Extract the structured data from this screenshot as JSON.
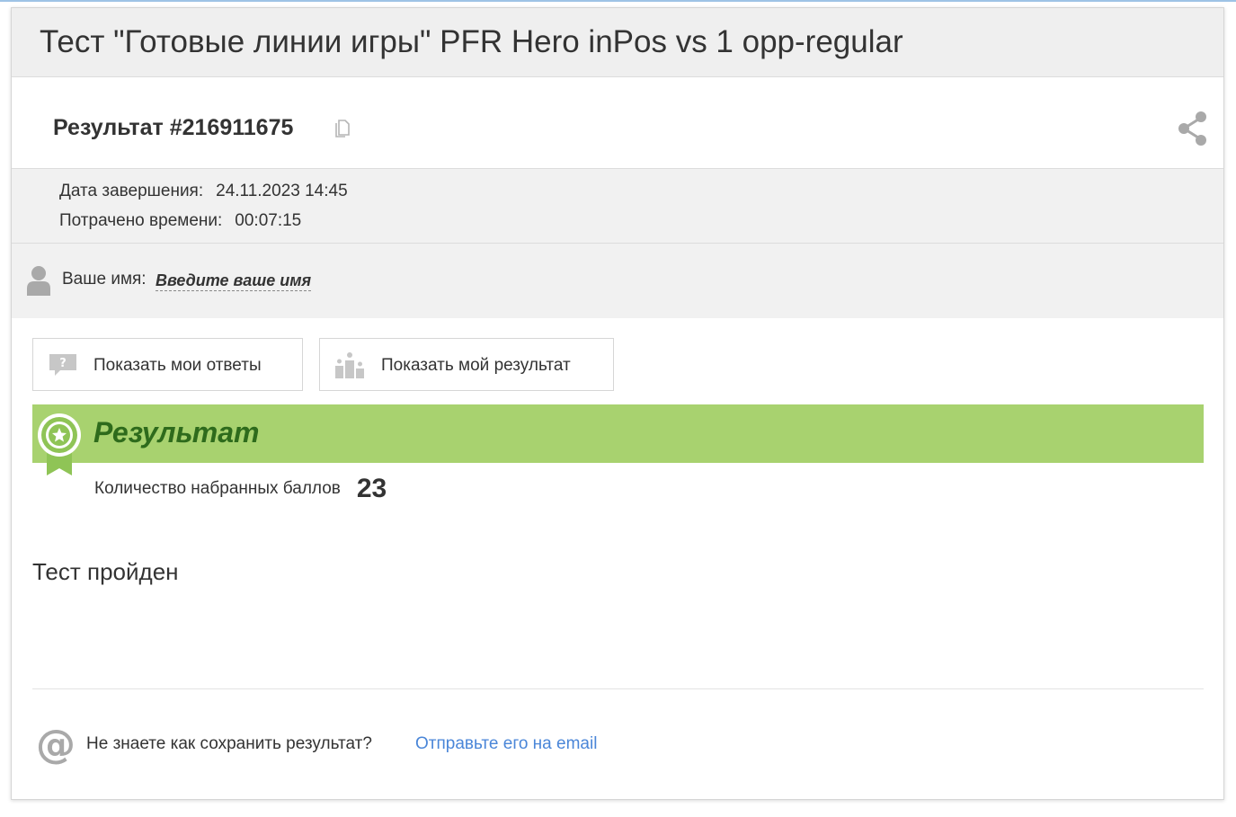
{
  "header": {
    "title": "Тест \"Готовые линии игры\" PFR Hero inPos vs 1 opp-regular"
  },
  "result": {
    "title": "Результат #216911675"
  },
  "meta": {
    "completion_label": "Дата завершения:",
    "completion_value": "24.11.2023 14:45",
    "time_label": "Потрачено времени:",
    "time_value": "00:07:15"
  },
  "name": {
    "label": "Ваше имя:",
    "placeholder": "Введите ваше имя"
  },
  "buttons": {
    "show_answers": "Показать мои ответы",
    "show_result": "Показать мой результат"
  },
  "result_section": {
    "title": "Результат",
    "score_label": "Количество набранных баллов",
    "score_value": "23",
    "status": "Тест пройден"
  },
  "save": {
    "question": "Не знаете как сохранить результат?",
    "link": "Отправьте его на email"
  },
  "colors": {
    "accent_green": "#a8d26f",
    "dark_green": "#2e6b1c",
    "link_blue": "#4a86d8",
    "icon_gray": "#a9a9a9"
  }
}
